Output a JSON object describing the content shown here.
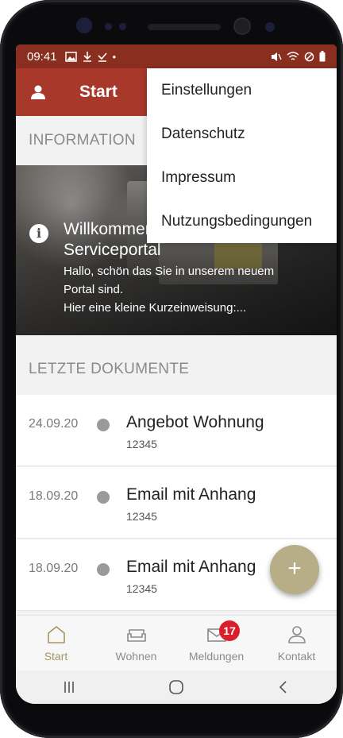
{
  "status_bar": {
    "time": "09:41",
    "left_icons": [
      "image-icon",
      "download-icon",
      "check-download-icon",
      "dot-icon"
    ],
    "right_icons": [
      "mute-icon",
      "wifi-icon",
      "no-sim-icon",
      "battery-icon"
    ]
  },
  "appbar": {
    "title": "Start",
    "profile_icon": "person-icon",
    "color": "#a8382a"
  },
  "overflow_menu": {
    "items": [
      {
        "label": "Einstellungen"
      },
      {
        "label": "Datenschutz"
      },
      {
        "label": "Impressum"
      },
      {
        "label": "Nutzungsbedingungen"
      }
    ]
  },
  "information": {
    "header": "INFORMATION",
    "card": {
      "title_line1": "Willkommen",
      "title_line2": "Serviceportal",
      "text_line1": "Hallo, schön das Sie in unserem neuem",
      "text_line2": "Portal sind.",
      "text_line3": "Hier eine kleine Kurzeinweisung:..."
    }
  },
  "documents": {
    "header": "LETZTE DOKUMENTE",
    "items": [
      {
        "date": "24.09.20",
        "name": "Angebot Wohnung",
        "number": "12345"
      },
      {
        "date": "18.09.20",
        "name": "Email mit Anhang",
        "number": "12345"
      },
      {
        "date": "18.09.20",
        "name": "Email mit Anhang",
        "number": "12345"
      }
    ]
  },
  "fab": {
    "label": "+",
    "color": "#b7ad87"
  },
  "bottom_nav": {
    "items": [
      {
        "label": "Start",
        "icon": "home-icon",
        "active": true
      },
      {
        "label": "Wohnen",
        "icon": "sofa-icon",
        "active": false
      },
      {
        "label": "Meldungen",
        "icon": "mail-icon",
        "active": false,
        "badge": "17"
      },
      {
        "label": "Kontakt",
        "icon": "person-outline-icon",
        "active": false
      }
    ],
    "active_color": "#a39563",
    "badge_color": "#d9202a"
  },
  "system_nav": {
    "icons": [
      "recent-apps-icon",
      "home-circle-icon",
      "back-icon"
    ]
  }
}
